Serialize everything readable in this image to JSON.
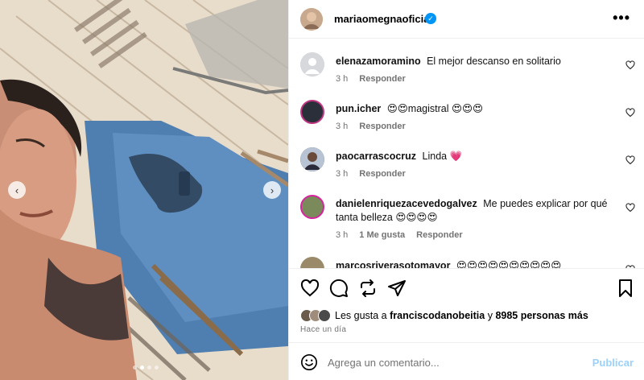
{
  "post": {
    "username": "mariaomegnaoficial",
    "verified_mark": "✓",
    "more_label": "•••",
    "carousel": {
      "prev": "‹",
      "next": "›",
      "slides": 4,
      "active": 1
    }
  },
  "comments": [
    {
      "user": "elenazamoramino",
      "text": "El mejor descanso en solitario",
      "time": "3 h",
      "likes": "",
      "reply": "Responder",
      "avatar_color": "#d0d3d8"
    },
    {
      "user": "pun.icher",
      "text": "😍😍magistral 😍😍😍",
      "time": "3 h",
      "likes": "",
      "reply": "Responder",
      "avatar_color": "#2b2f3a"
    },
    {
      "user": "paocarrascocruz",
      "text": "Linda 💗",
      "time": "3 h",
      "likes": "",
      "reply": "Responder",
      "avatar_color": "#5a6a8a"
    },
    {
      "user": "danielenriquezacevedogalvez",
      "text": "Me puedes explicar por qué tanta belleza 😍😍😍😍",
      "time": "3 h",
      "likes": "1 Me gusta",
      "reply": "Responder",
      "avatar_color": "#7a8a5a"
    },
    {
      "user": "marcosriverasotomayor",
      "text": "😍😍😍😍😍😍😍😍😍😍",
      "time": "",
      "likes": "",
      "reply": "",
      "avatar_color": "#9a8a6a"
    }
  ],
  "likes": {
    "prefix": "Les gusta a",
    "user": "franciscodanobeitia",
    "conj": "y",
    "count": "8985 personas más"
  },
  "timestamp": "Hace un día",
  "composer": {
    "placeholder": "Agrega un comentario...",
    "publish": "Publicar"
  },
  "colors": {
    "link_blue": "#0095f6",
    "publish_disabled": "#9bd1fb",
    "meta_gray": "#737373"
  }
}
